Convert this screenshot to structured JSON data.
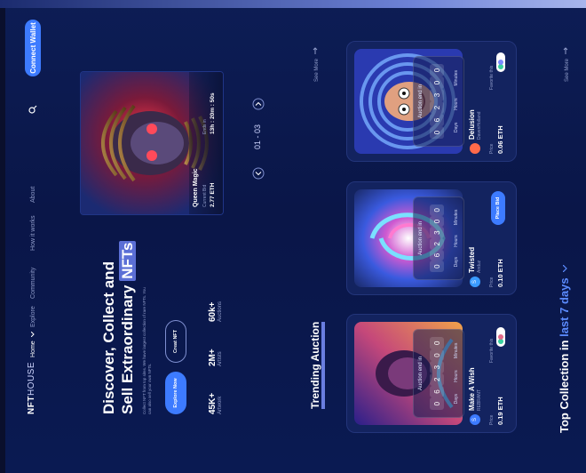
{
  "brand": {
    "name_a": "NFT",
    "name_b": "HOUSE"
  },
  "nav": {
    "items": [
      "Home",
      "Explore",
      "Community",
      "How it works",
      "About"
    ],
    "active_index": 0
  },
  "header": {
    "connect_wallet": "Connect Wallet"
  },
  "hero": {
    "title_line1": "Discover, Collect and",
    "title_line2a": "Sell Extraordinary ",
    "title_line2b": "NFTs",
    "description": "Collect NFT from top sites. We have largest collection of rare NFTs. You can also sell your own NFTs.",
    "explore_button": "Explore Now",
    "create_button": "Creat NFT",
    "stats": [
      {
        "value": "45K+",
        "label": "Artwork"
      },
      {
        "value": "2M+",
        "label": "Artists"
      },
      {
        "value": "60k+",
        "label": "Auctions"
      }
    ]
  },
  "featured": {
    "name": "Queen Magic",
    "bid_label": "Current Bid",
    "bid_value": "2.77 ETH",
    "ends_label": "Ends in",
    "ends_value": "13h : 20m : 50s",
    "pager": "01 - 03"
  },
  "trending": {
    "title": "Trending Auction",
    "see_more": "See More",
    "cards": [
      {
        "timer_label": "Auction end in",
        "digits": [
          "0",
          "6",
          "2",
          "3",
          "0",
          "0",
          "2",
          "2"
        ],
        "units": [
          "Days",
          "Hours",
          "Minutes"
        ],
        "name": "Make A Wish",
        "creator": "REBRANT",
        "price_label": "Price",
        "price": "0.19 ETH",
        "fav_label": "Favorite this",
        "accent": "#e46a8a"
      },
      {
        "timer_label": "Auction end in",
        "digits": [
          "0",
          "6",
          "2",
          "3",
          "0",
          "0",
          "2",
          "2"
        ],
        "units": [
          "Days",
          "Hours",
          "Minutes"
        ],
        "name": "Twisted",
        "creator": "Anduz",
        "price_label": "Price",
        "price": "0.10 ETH",
        "place_bid": "Place Bid",
        "accent": "#3a9bff"
      },
      {
        "timer_label": "Auction end in",
        "digits": [
          "0",
          "6",
          "2",
          "3",
          "0",
          "0",
          "2",
          "2"
        ],
        "units": [
          "Days",
          "Hours",
          "Minutes"
        ],
        "name": "Delusion",
        "creator": "DavenHolland",
        "price_label": "Price",
        "price": "0.06 ETH",
        "fav_label": "Favorite this",
        "accent": "#ff6a4a"
      }
    ]
  },
  "collection": {
    "title_a": "Top Collection in ",
    "title_b": "last 7 days",
    "see_more": "See More"
  },
  "colors": {
    "accent_blue": "#3d7bff",
    "bg": "#0a1648",
    "highlight": "#9db4ff"
  },
  "icons": [
    "search-icon",
    "arrow-right-icon",
    "chevron-left-icon",
    "chevron-right-icon",
    "chevron-down-icon",
    "heart-icon",
    "avatar"
  ]
}
